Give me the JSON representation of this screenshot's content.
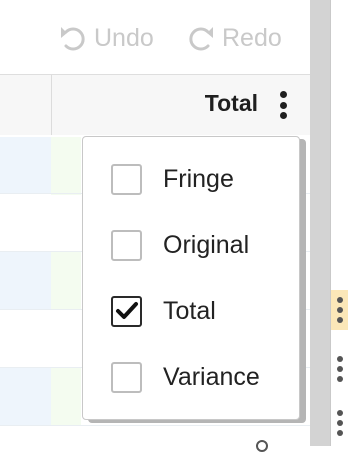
{
  "toolbar": {
    "undo_label": "Undo",
    "redo_label": "Redo"
  },
  "header": {
    "column_title": "Total"
  },
  "menu": {
    "items": [
      {
        "label": "Fringe",
        "checked": false
      },
      {
        "label": "Original",
        "checked": false
      },
      {
        "label": "Total",
        "checked": true
      },
      {
        "label": "Variance",
        "checked": false
      }
    ]
  },
  "colors": {
    "selected_cell": "#fbe7b8",
    "menu_border": "#c8c8c8"
  }
}
